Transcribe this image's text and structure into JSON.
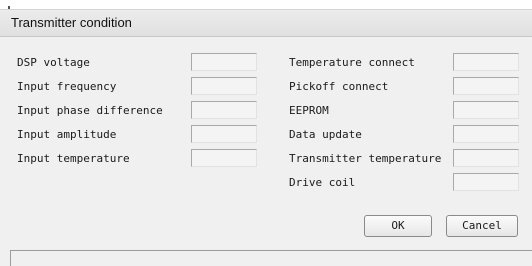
{
  "window": {
    "title": "Transmitter condition"
  },
  "left_column": [
    {
      "label": "DSP voltage",
      "value": ""
    },
    {
      "label": "Input frequency",
      "value": ""
    },
    {
      "label": "Input phase difference",
      "value": ""
    },
    {
      "label": "Input amplitude",
      "value": ""
    },
    {
      "label": "Input temperature",
      "value": ""
    }
  ],
  "right_column": [
    {
      "label": "Temperature connect",
      "value": ""
    },
    {
      "label": "Pickoff connect",
      "value": ""
    },
    {
      "label": "EEPROM",
      "value": ""
    },
    {
      "label": "Data update",
      "value": ""
    },
    {
      "label": "Transmitter temperature",
      "value": ""
    },
    {
      "label": "Drive coil",
      "value": ""
    }
  ],
  "buttons": {
    "ok": "OK",
    "cancel": "Cancel"
  }
}
